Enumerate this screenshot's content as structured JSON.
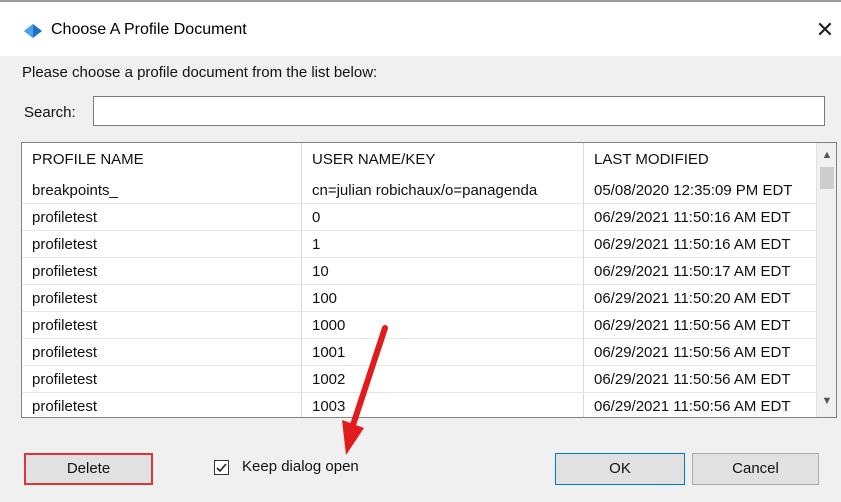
{
  "window": {
    "title": "Choose A Profile Document",
    "close_label": "✕"
  },
  "prompt": "Please choose a profile document from the list below:",
  "search": {
    "label": "Search:",
    "value": "",
    "placeholder": ""
  },
  "table": {
    "columns": [
      "PROFILE NAME",
      "USER NAME/KEY",
      "LAST MODIFIED"
    ],
    "rows": [
      [
        "breakpoints_",
        "cn=julian robichaux/o=panagenda",
        "05/08/2020 12:35:09 PM EDT"
      ],
      [
        "profiletest",
        "0",
        "06/29/2021 11:50:16 AM EDT"
      ],
      [
        "profiletest",
        "1",
        "06/29/2021 11:50:16 AM EDT"
      ],
      [
        "profiletest",
        "10",
        "06/29/2021 11:50:17 AM EDT"
      ],
      [
        "profiletest",
        "100",
        "06/29/2021 11:50:20 AM EDT"
      ],
      [
        "profiletest",
        "1000",
        "06/29/2021 11:50:56 AM EDT"
      ],
      [
        "profiletest",
        "1001",
        "06/29/2021 11:50:56 AM EDT"
      ],
      [
        "profiletest",
        "1002",
        "06/29/2021 11:50:56 AM EDT"
      ],
      [
        "profiletest",
        "1003",
        "06/29/2021 11:50:56 AM EDT"
      ]
    ]
  },
  "buttons": {
    "delete": "Delete",
    "ok": "OK",
    "cancel": "Cancel"
  },
  "keep_open": {
    "label": "Keep dialog open",
    "checked": true
  },
  "colors": {
    "annotation_arrow": "#e01c1c",
    "delete_highlight": "#e03535",
    "ok_border": "#0078d7"
  }
}
